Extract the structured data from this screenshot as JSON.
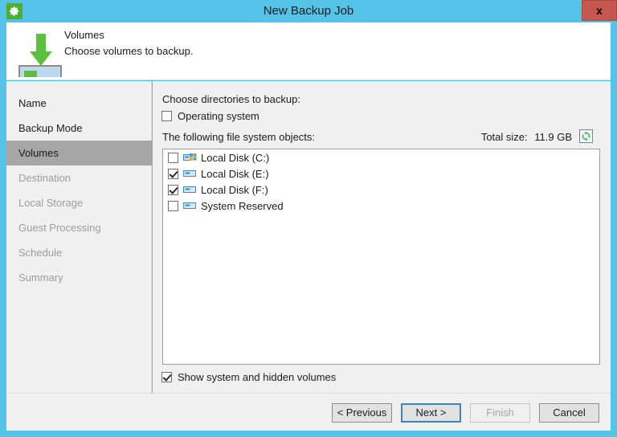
{
  "window": {
    "title": "New Backup Job",
    "app_icon": "gear-icon",
    "close_label": "x",
    "accent_color": "#55c3e7",
    "close_color": "#c4584f"
  },
  "header": {
    "title": "Volumes",
    "subtitle": "Choose volumes to backup.",
    "icon": "green-down-arrow-to-disk-icon"
  },
  "sidebar": {
    "items": [
      {
        "label": "Name",
        "state": "done"
      },
      {
        "label": "Backup Mode",
        "state": "done"
      },
      {
        "label": "Volumes",
        "state": "active"
      },
      {
        "label": "Destination",
        "state": "disabled"
      },
      {
        "label": "Local Storage",
        "state": "disabled"
      },
      {
        "label": "Guest Processing",
        "state": "disabled"
      },
      {
        "label": "Schedule",
        "state": "disabled"
      },
      {
        "label": "Summary",
        "state": "disabled"
      }
    ]
  },
  "main": {
    "choose_label": "Choose directories to backup:",
    "operating_system": {
      "label": "Operating system",
      "checked": false
    },
    "objects_label": "The following file system objects:",
    "total_size_label": "Total size:",
    "total_size_value": "11.9 GB",
    "refresh_icon": "refresh-icon",
    "volumes": [
      {
        "label": "Local Disk (C:)",
        "checked": false,
        "icon": "windows-system-disk-icon"
      },
      {
        "label": "Local Disk (E:)",
        "checked": true,
        "icon": "disk-icon"
      },
      {
        "label": "Local Disk (F:)",
        "checked": true,
        "icon": "disk-icon"
      },
      {
        "label": "System Reserved",
        "checked": false,
        "icon": "disk-icon"
      }
    ],
    "show_hidden": {
      "label": "Show system and hidden volumes",
      "checked": true
    }
  },
  "footer": {
    "previous": "< Previous",
    "next": "Next >",
    "finish": "Finish",
    "cancel": "Cancel"
  }
}
